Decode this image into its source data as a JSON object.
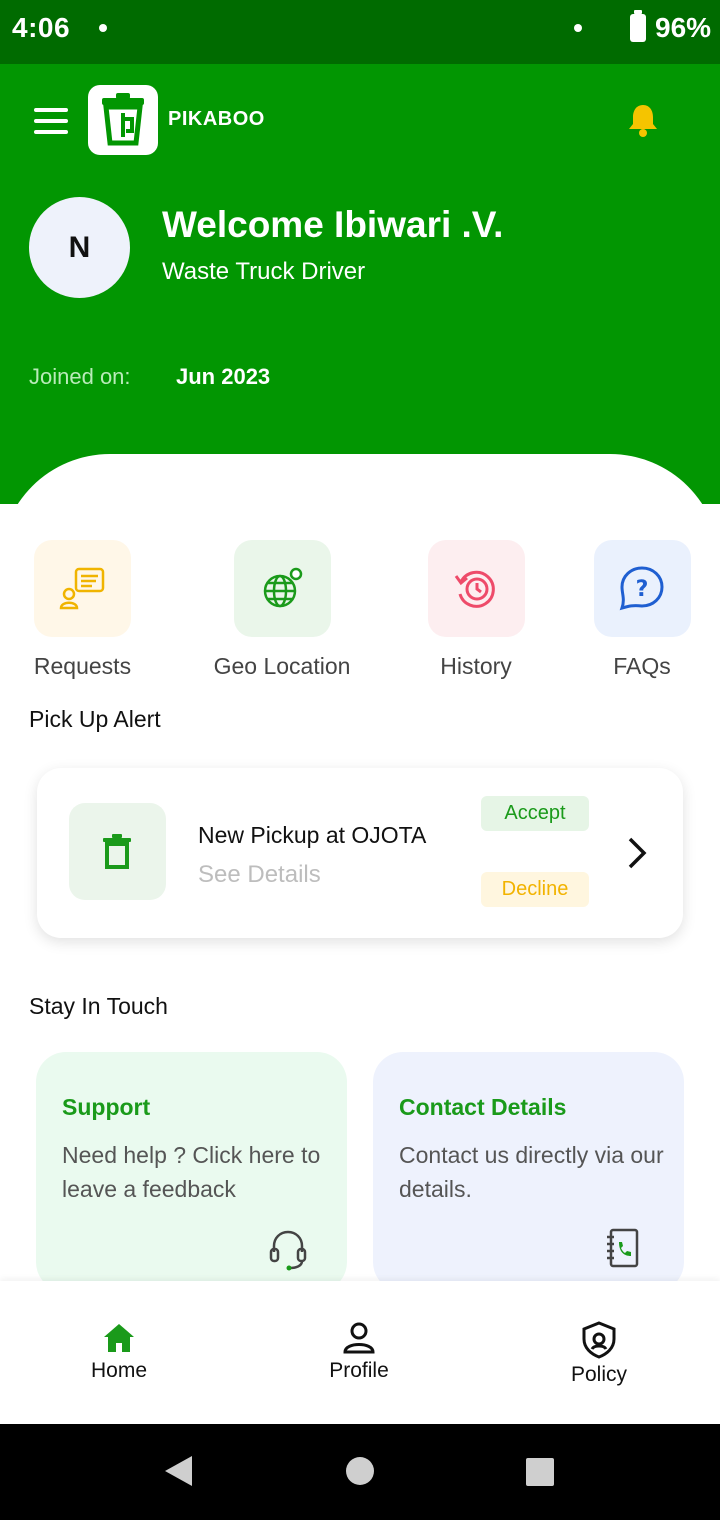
{
  "status_bar": {
    "time": "4:06",
    "battery": "96%"
  },
  "header": {
    "brand": "PIKABOO",
    "avatar_initial": "N",
    "welcome": "Welcome Ibiwari .V.",
    "role": "Waste Truck Driver",
    "joined_label": "Joined on:",
    "joined_value": "Jun 2023",
    "colors": {
      "primary": "#029602",
      "status_bar": "#006b00",
      "bell": "#f5c400"
    }
  },
  "quick_actions": [
    {
      "label": "Requests",
      "icon": "chat-user-icon"
    },
    {
      "label": "Geo Location",
      "icon": "globe-pin-icon"
    },
    {
      "label": "History",
      "icon": "history-clock-icon"
    },
    {
      "label": "FAQs",
      "icon": "question-bubble-icon"
    }
  ],
  "pickup_alert": {
    "section_title": "Pick Up Alert",
    "title": "New Pickup at OJOTA",
    "details_link": "See Details",
    "accept_label": "Accept",
    "decline_label": "Decline"
  },
  "stay_in_touch": {
    "section_title": "Stay In Touch",
    "cards": [
      {
        "title": "Support",
        "description": "Need help ? Click here to leave a feedback",
        "icon": "headset-icon"
      },
      {
        "title": "Contact Details",
        "description": "Contact us directly via our details.",
        "icon": "phonebook-icon"
      }
    ]
  },
  "bottom_nav": [
    {
      "label": "Home",
      "icon": "home-icon",
      "active": true
    },
    {
      "label": "Profile",
      "icon": "person-icon",
      "active": false
    },
    {
      "label": "Policy",
      "icon": "shield-icon",
      "active": false
    }
  ]
}
